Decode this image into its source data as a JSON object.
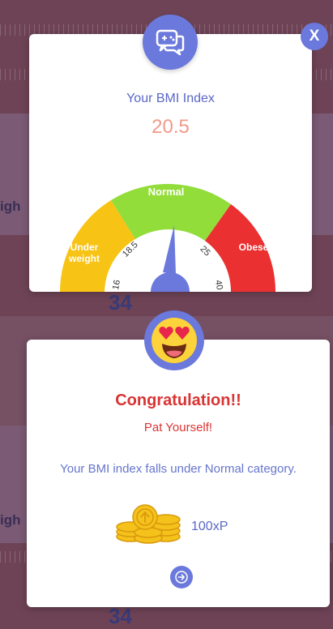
{
  "background": {
    "number_fragment": "34",
    "side_fragment": "igh"
  },
  "bmi_modal": {
    "icon": "chat-bubbles-icon",
    "close_label": "X",
    "title": "Your BMI Index",
    "value": "20.5",
    "gauge": {
      "segments": [
        {
          "label_line1": "Under",
          "label_line2": "weight",
          "color": "#f7c314"
        },
        {
          "label_line1": "Normal",
          "label_line2": "",
          "color": "#92dd3a"
        },
        {
          "label_line1": "Obese",
          "label_line2": "",
          "color": "#ea3030"
        }
      ],
      "ticks": [
        "16",
        "18.5",
        "25",
        "40"
      ],
      "needle_color": "#6b79dc",
      "needle_value": 20.5
    }
  },
  "congrats_modal": {
    "emoji": "heart-eyes-emoji-icon",
    "heading": "Congratulation!!",
    "subheading": "Pat Yourself!",
    "message": "Your BMI index falls under Normal category.",
    "reward_icon": "gold-coins-icon",
    "reward": "100xP",
    "next_icon": "arrow-right-icon"
  },
  "colors": {
    "accent": "#6b79dc",
    "value": "#f09a8a",
    "alert": "#d93434"
  }
}
